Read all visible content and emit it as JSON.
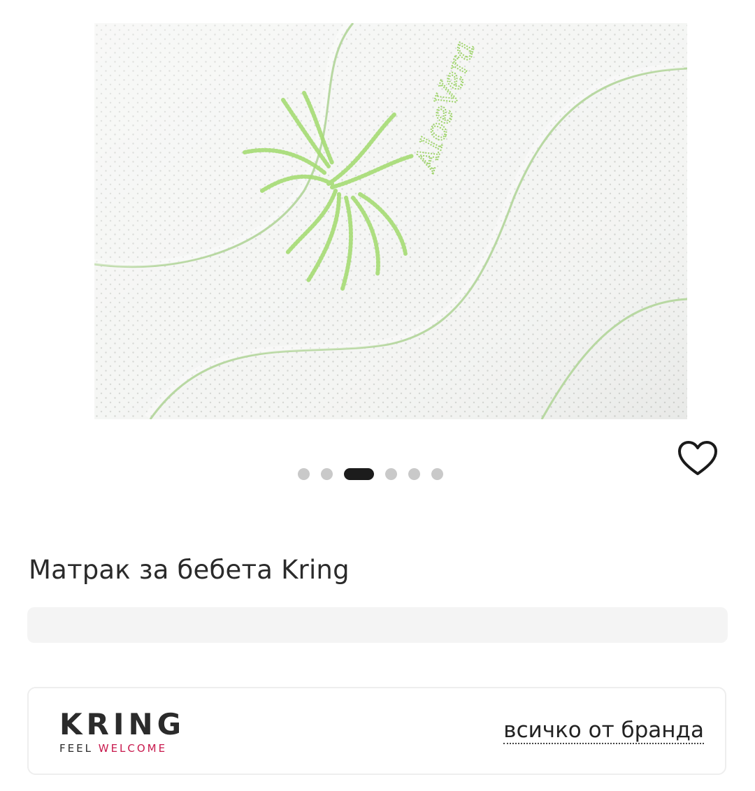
{
  "product": {
    "title": "Матрак за бебета Kring",
    "image": {
      "subject": "mattress-fabric-aloe-vera-close-up",
      "fabric_text": "AloeVera"
    }
  },
  "carousel": {
    "slide_count": 6,
    "active_index": 2
  },
  "favorite": {
    "icon": "heart-outline-icon"
  },
  "brand": {
    "logo_text": "KRING",
    "tagline_part1": "FEEL",
    "tagline_part2": "WELCOME",
    "link_label": "всичко от бранда"
  },
  "colors": {
    "brand_accent": "#c8194d",
    "active_dot": "#1c1c1c",
    "inactive_dot": "#c9c9c9",
    "aloe_green": "#9ed86a"
  }
}
